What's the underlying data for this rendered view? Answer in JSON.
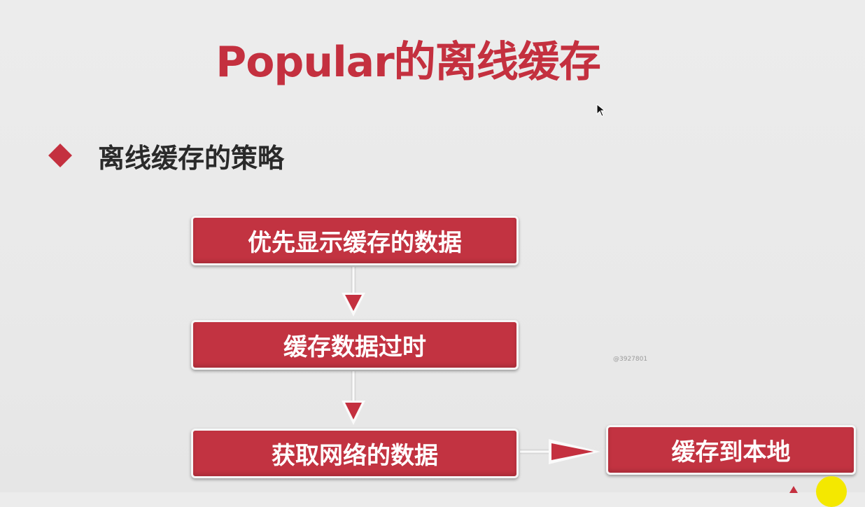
{
  "slide": {
    "title": "Popular的离线缓存",
    "bullet": "离线缓存的策略"
  },
  "flow": {
    "step1": "优先显示缓存的数据",
    "step2": "缓存数据过时",
    "step3": "获取网络的数据",
    "step4": "缓存到本地"
  },
  "watermark": "@3927801",
  "colors": {
    "accent": "#c4303f",
    "box_fill": "#c23341",
    "text_dark": "#2a2a2a",
    "background": "#ebebeb"
  }
}
